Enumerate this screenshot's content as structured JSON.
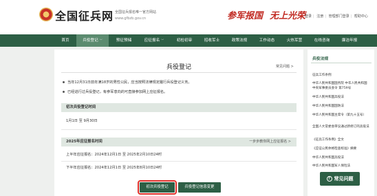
{
  "header": {
    "title": "全国征兵网",
    "subtitle": "全国征兵报名唯一官方网站",
    "url": "www.gfbzb.gov.cn",
    "slogan_1": "参军报国",
    "slogan_2": "无上光荣",
    "links": [
      "登录",
      "注册",
      "管理部门登录",
      "帮助中心"
    ]
  },
  "nav": {
    "items": [
      {
        "label": "首页"
      },
      {
        "label": "兵役登记",
        "caret": "﹀",
        "active": true
      },
      {
        "label": "预征预储"
      },
      {
        "label": "应征报名",
        "caret": "﹀"
      },
      {
        "label": "初检初审"
      },
      {
        "label": "招收军士"
      },
      {
        "label": "政策法规"
      },
      {
        "label": "工作动态"
      },
      {
        "label": "火热军营"
      },
      {
        "label": "在线咨询"
      },
      {
        "label": "廉洁年报"
      }
    ]
  },
  "main": {
    "title": "兵役登记",
    "back": "常见问题 >",
    "notes": [
      "当年12月31日前年满18岁的男性公民，应当按照法律规定履行兵役登记义务。",
      "已经进行过兵役登记，有参军意向的可直接参加网上应征报名。"
    ],
    "section1": {
      "title": "初次兵役登记时间",
      "line": "1月1日 至 9月30日"
    },
    "section2": {
      "title": "2025年应征报名时间",
      "hint": "一步步教你网上应征报名 >",
      "line1": "上半年应征报名：2024年12月1日 至 2025年2月10日24时",
      "line2": "下半年应征报名：2024年12月1日 至 2025年8月10日24时"
    },
    "buttons": {
      "primary": "初次兵役登记",
      "secondary": "兵役登记信息变更"
    }
  },
  "sidebar": {
    "title": "兵役法规",
    "links": [
      "征兵工作条例",
      "中华人民共和国国务院 中华人民共和国中央军事委员会令 第759号",
      "中华人民共和国兵役法",
      "中华人民共和国国防法",
      "中华人民共和国主席令（第九十五号）",
      "全国人大常委会审议通过新修订的兵役法",
      "《征兵工作条例》全文",
      "《应征公民体格检查标准》摘要",
      "中华人民共和国兵役法",
      "中华人民共和国军人保险法"
    ],
    "faq": "常见问题",
    "faq_icon": "?"
  },
  "colors": {
    "brand_green": "#2d5f45",
    "active_green": "#5b8b6f",
    "slogan_red": "#c12a22",
    "highlight_red": "#e0302a"
  }
}
